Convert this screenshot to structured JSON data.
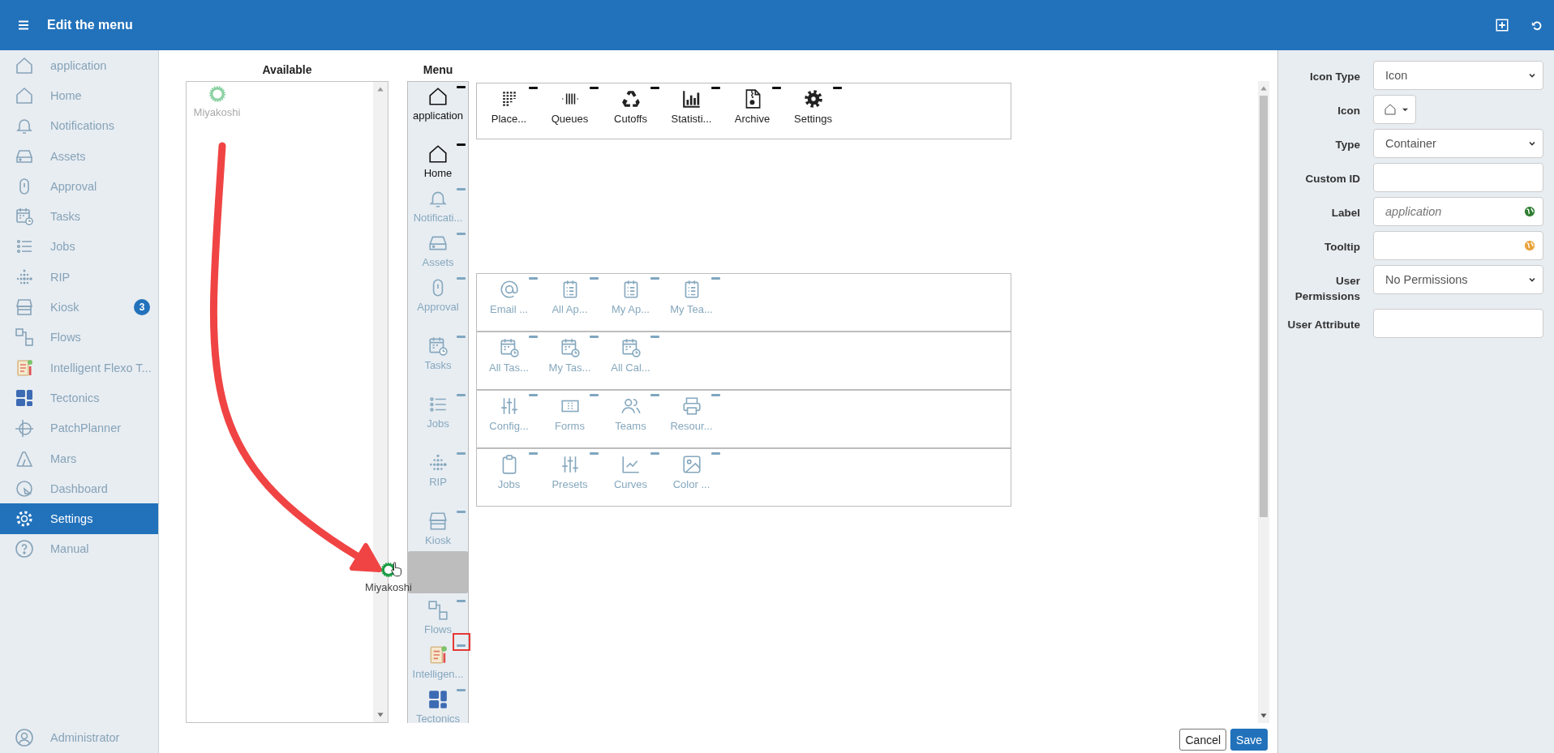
{
  "topbar": {
    "title": "Edit the menu"
  },
  "sidebar": {
    "items": [
      {
        "label": "application",
        "selected": false
      },
      {
        "label": "Home",
        "selected": false
      },
      {
        "label": "Notifications",
        "selected": false
      },
      {
        "label": "Assets",
        "selected": false
      },
      {
        "label": "Approval",
        "selected": false
      },
      {
        "label": "Tasks",
        "selected": false
      },
      {
        "label": "Jobs",
        "selected": false
      },
      {
        "label": "RIP",
        "selected": false
      },
      {
        "label": "Kiosk",
        "selected": false,
        "badge": "3"
      },
      {
        "label": "Flows",
        "selected": false
      },
      {
        "label": "Intelligent Flexo T...",
        "selected": false
      },
      {
        "label": "Tectonics",
        "selected": false
      },
      {
        "label": "PatchPlanner",
        "selected": false
      },
      {
        "label": "Mars",
        "selected": false
      },
      {
        "label": "Dashboard",
        "selected": false
      },
      {
        "label": "Settings",
        "selected": true
      },
      {
        "label": "Manual",
        "selected": false
      }
    ],
    "user": "Administrator"
  },
  "available": {
    "title": "Available",
    "items": [
      {
        "label": "Miyakoshi",
        "dragging": true
      }
    ]
  },
  "menu": {
    "title": "Menu",
    "items": [
      {
        "kind": "item",
        "label": "application",
        "muted": false,
        "annotated": false,
        "children": [
          {
            "label": "Place...",
            "muted": false
          },
          {
            "label": "Queues",
            "muted": false
          },
          {
            "label": "Cutoffs",
            "muted": false
          },
          {
            "label": "Statisti...",
            "muted": false
          },
          {
            "label": "Archive",
            "muted": false
          },
          {
            "label": "Settings",
            "muted": false
          }
        ]
      },
      {
        "kind": "item",
        "label": "Home",
        "muted": false,
        "annotated": false
      },
      {
        "kind": "item",
        "label": "Notificati...",
        "muted": true,
        "annotated": false
      },
      {
        "kind": "item",
        "label": "Assets",
        "muted": true,
        "annotated": false
      },
      {
        "kind": "item",
        "label": "Approval",
        "muted": true,
        "annotated": false,
        "children": [
          {
            "label": "Email ...",
            "muted": true
          },
          {
            "label": "All Ap...",
            "muted": true
          },
          {
            "label": "My Ap...",
            "muted": true
          },
          {
            "label": "My Tea...",
            "muted": true
          }
        ]
      },
      {
        "kind": "item",
        "label": "Tasks",
        "muted": true,
        "annotated": false,
        "children": [
          {
            "label": "All Tas...",
            "muted": true
          },
          {
            "label": "My Tas...",
            "muted": true
          },
          {
            "label": "All Cal...",
            "muted": true
          }
        ]
      },
      {
        "kind": "item",
        "label": "Jobs",
        "muted": true,
        "annotated": false,
        "children": [
          {
            "label": "Config...",
            "muted": true
          },
          {
            "label": "Forms",
            "muted": true
          },
          {
            "label": "Teams",
            "muted": true
          },
          {
            "label": "Resour...",
            "muted": true
          }
        ]
      },
      {
        "kind": "item",
        "label": "RIP",
        "muted": true,
        "annotated": false,
        "children": [
          {
            "label": "Jobs",
            "muted": true
          },
          {
            "label": "Presets",
            "muted": true
          },
          {
            "label": "Curves",
            "muted": true
          },
          {
            "label": "Color ...",
            "muted": true
          }
        ]
      },
      {
        "kind": "item",
        "label": "Kiosk",
        "muted": true,
        "annotated": false
      },
      {
        "kind": "placeholder"
      },
      {
        "kind": "item",
        "label": "Flows",
        "muted": true,
        "annotated": false
      },
      {
        "kind": "item",
        "label": "Intelligen...",
        "muted": true,
        "annotated": true
      },
      {
        "kind": "item",
        "label": "Tectonics",
        "muted": true,
        "annotated": false
      }
    ]
  },
  "drag": {
    "label": "Miyakoshi",
    "arrow": true
  },
  "form": {
    "fields": [
      {
        "label": "Icon Type",
        "kind": "select",
        "value": "Icon"
      },
      {
        "label": "Icon",
        "kind": "icon-picker"
      },
      {
        "label": "Type",
        "kind": "select",
        "value": "Container"
      },
      {
        "label": "Custom ID",
        "kind": "text"
      },
      {
        "label": "Label",
        "kind": "text",
        "placeholder": "application",
        "color": "#2e7d32"
      },
      {
        "label": "Tooltip",
        "kind": "text",
        "color": "#e8a23a"
      },
      {
        "label": "User Permissions",
        "kind": "select",
        "value": "No Permissions"
      },
      {
        "label": "User Attribute",
        "kind": "text"
      }
    ]
  },
  "buttons": {
    "cancel": "Cancel",
    "save": "Save"
  }
}
